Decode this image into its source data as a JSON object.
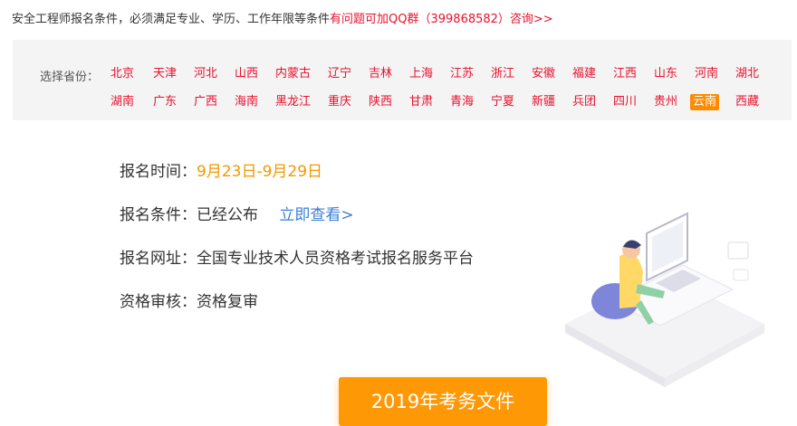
{
  "notice": {
    "text": "安全工程师报名条件，必须满足专业、学历、工作年限等条件",
    "link": "有问题可加QQ群（399868582）咨询>>"
  },
  "provinces": {
    "label": "选择省份：",
    "selected": "云南",
    "row1": [
      "北京",
      "天津",
      "河北",
      "山西",
      "内蒙古",
      "辽宁",
      "吉林",
      "上海",
      "江苏",
      "浙江",
      "安徽",
      "福建",
      "江西",
      "山东",
      "河南",
      "湖北"
    ],
    "row2": [
      "湖南",
      "广东",
      "广西",
      "海南",
      "黑龙江",
      "重庆",
      "陕西",
      "甘肃",
      "青海",
      "宁夏",
      "新疆",
      "兵团",
      "四川",
      "贵州",
      "云南",
      "西藏"
    ]
  },
  "info": {
    "time_label": "报名时间：",
    "time_value": "9月23日-9月29日",
    "cond_label": "报名条件：",
    "cond_value": "已经公布",
    "cond_link": "立即查看>",
    "site_label": "报名网址：",
    "site_value": "全国专业技术人员资格考试报名服务平台",
    "review_label": "资格审核：",
    "review_value": "资格复审"
  },
  "cta": {
    "label": "2019年考务文件"
  },
  "colors": {
    "accent_red": "#e8112d",
    "orange": "#ff9805",
    "blue": "#3b7fd4"
  }
}
